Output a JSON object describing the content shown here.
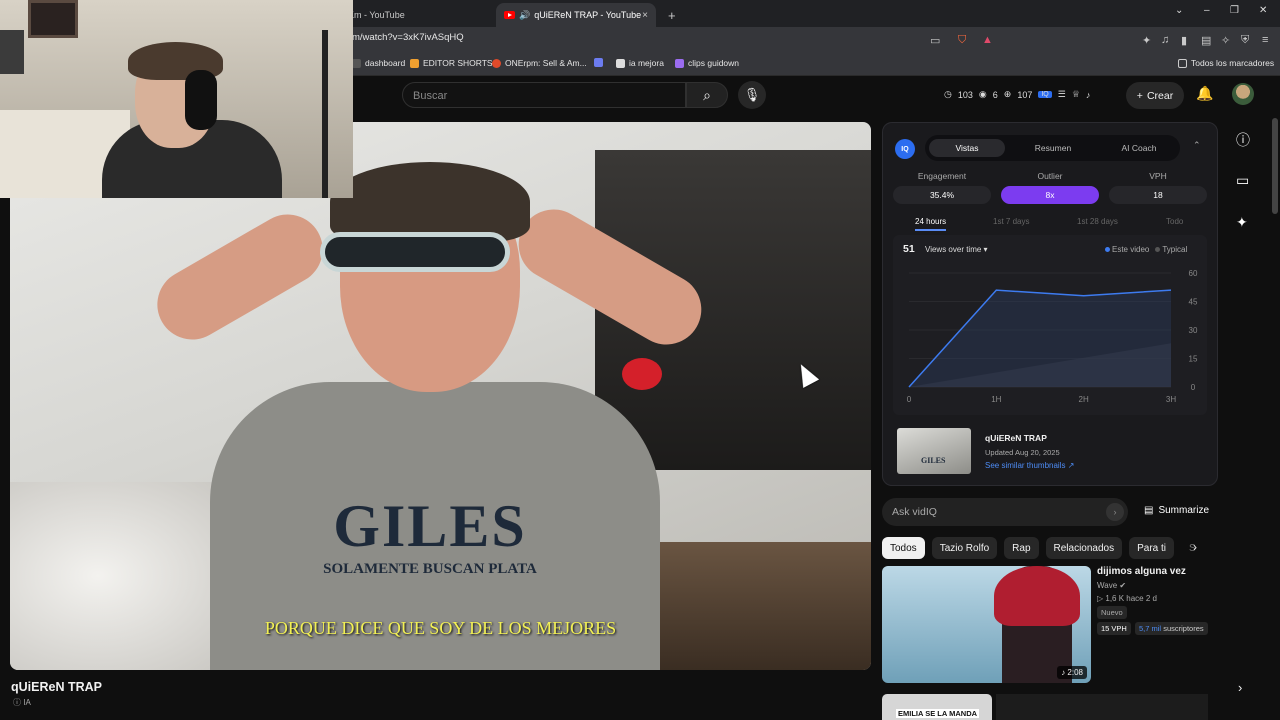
{
  "browser": {
    "tabs": [
      {
        "label": "Km - YouTube"
      },
      {
        "label": "qUiEReN TRAP - YouTube",
        "close": "×"
      }
    ],
    "new_tab": "+",
    "window_controls": [
      "⌄",
      "–",
      "❐",
      "✕"
    ],
    "url": "m/watch?v=3xK7ivASqHQ",
    "bookmarks": [
      "dashboard",
      "EDITOR SHORTS",
      "ONErpm: Sell & Am...",
      "ia mejora",
      "clips guidown"
    ],
    "all_bookmarks": "Todos los marcadores"
  },
  "header": {
    "search_placeholder": "Buscar",
    "stats": {
      "a": "103",
      "b": "6",
      "c": "107"
    },
    "create_label": "Crear"
  },
  "video": {
    "shirt_big": "GILES",
    "shirt_small": "SOLAMENTE BUSCAN PLATA",
    "caption": "PORQUE DICE QUE SOY DE LOS MEJORES",
    "title": "qUiEReN TRAP",
    "badge": "IA"
  },
  "vidiq": {
    "logo": "IQ",
    "tabs": [
      "Vistas",
      "Resumen",
      "AI Coach"
    ],
    "metrics": [
      {
        "label": "Engagement",
        "value": "35.4%"
      },
      {
        "label": "Outlier",
        "value": "8x"
      },
      {
        "label": "VPH",
        "value": "18"
      }
    ],
    "periods": [
      "24 hours",
      "1st 7 days",
      "1st 28 days",
      "Todo"
    ],
    "chart_count": "51",
    "chart_metric": "Views over time",
    "legend": [
      "Este video",
      "Typical"
    ],
    "thumb": {
      "title": "qUiEReN TRAP",
      "updated": "Updated Aug 20, 2025",
      "link": "See similar thumbnails ↗",
      "mini_text": "GILES"
    },
    "ask_placeholder": "Ask vidIQ",
    "summarize": "Summarize"
  },
  "chart_data": {
    "type": "line",
    "x": [
      "0",
      "1H",
      "2H",
      "3H"
    ],
    "xlabel": "",
    "ylabel": "",
    "ylim": [
      0,
      60
    ],
    "yticks": [
      0,
      15,
      30,
      45,
      60
    ],
    "series": [
      {
        "name": "Este video",
        "points": [
          [
            0,
            0
          ],
          [
            1,
            51
          ],
          [
            2,
            48
          ],
          [
            3,
            51
          ]
        ],
        "color": "#3d7bf0"
      },
      {
        "name": "Typical",
        "points": [
          [
            0,
            0
          ],
          [
            3,
            23
          ]
        ],
        "color": "#555"
      }
    ]
  },
  "chips": [
    "Todos",
    "Tazio Rolfo",
    "Rap",
    "Relacionados",
    "Para ti",
    "S"
  ],
  "recommended": {
    "title": "dijimos alguna vez",
    "channel": "Wave",
    "meta": "1,6 K  hace 2 d",
    "badge": "Nuevo",
    "vph": "15 VPH",
    "subs_num": "5,7 mil",
    "subs_label": "suscriptores",
    "duration": "2:08",
    "second_text": "EMILIA SE LA MANDA"
  },
  "colors": {
    "accent": "#3d7bf0",
    "outlier": "#7c3cf0",
    "yt_red": "#ff0000"
  }
}
